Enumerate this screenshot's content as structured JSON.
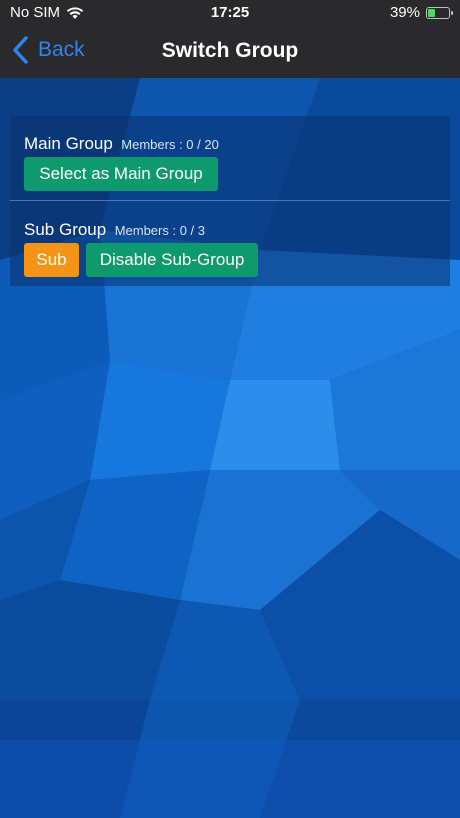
{
  "status_bar": {
    "carrier": "No SIM",
    "time": "17:25",
    "battery_percent_label": "39%",
    "battery_level": 0.39,
    "wifi_icon": "wifi-icon",
    "battery_icon": "battery-charging-icon"
  },
  "nav": {
    "back_label": "Back",
    "title": "Switch Group",
    "back_icon": "chevron-left-icon",
    "accent_color": "#2f86f0"
  },
  "groups": {
    "main": {
      "title": "Main Group",
      "members": "Members : 0 / 20",
      "button_label": "Select as Main Group"
    },
    "sub": {
      "title": "Sub Group",
      "members": "Members : 0 / 3",
      "sub_button_label": "Sub",
      "disable_button_label": "Disable Sub-Group"
    }
  },
  "colors": {
    "green_button": "#0f9a6e",
    "orange_button": "#f39416",
    "bar_background": "#2a2a2c"
  }
}
